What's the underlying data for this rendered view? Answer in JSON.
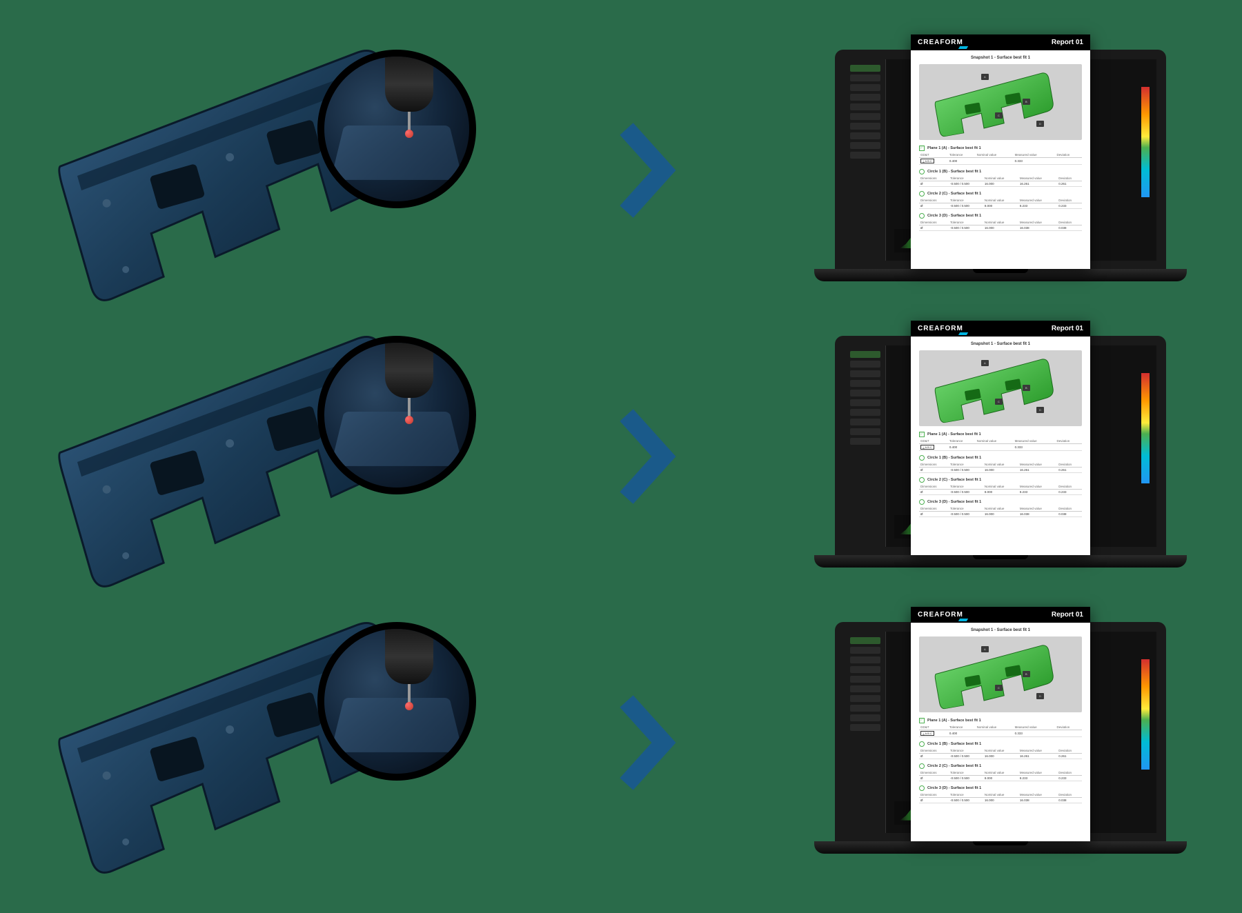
{
  "arrow_color": "#1a5a8a",
  "report": {
    "brand": "CREAFORM",
    "title": "Report 01",
    "snapshot": "Snapshot 1 - Surface best fit 1",
    "callouts": [
      "A",
      "B",
      "C",
      "D"
    ],
    "sections": [
      {
        "glyph": "plane",
        "title": "Plane 1 (A) - Surface best fit 1",
        "headers": [
          "GD&T",
          "Tolerance",
          "Nominal value",
          "Measured value",
          "Deviation"
        ],
        "rows": [
          [
            "⟂ A B C",
            "0.400",
            "",
            "0.333",
            ""
          ]
        ]
      },
      {
        "glyph": "circle",
        "title": "Circle 1 (B) - Surface best fit 1",
        "headers": [
          "Dimensions",
          "Tolerance",
          "Nominal value",
          "Measured value",
          "Deviation"
        ],
        "rows": [
          [
            "Ø",
            "-0.500 / 0.500",
            "16.000",
            "16.261",
            "0.261"
          ]
        ]
      },
      {
        "glyph": "circle",
        "title": "Circle 2 (C) - Surface best fit 1",
        "headers": [
          "Dimensions",
          "Tolerance",
          "Nominal value",
          "Measured value",
          "Deviation"
        ],
        "rows": [
          [
            "Ø",
            "-0.500 / 0.500",
            "8.000",
            "8.233",
            "0.233"
          ]
        ]
      },
      {
        "glyph": "circle",
        "title": "Circle 3 (D) - Surface best fit 1",
        "headers": [
          "Dimensions",
          "Tolerance",
          "Nominal value",
          "Measured value",
          "Deviation"
        ],
        "rows": [
          [
            "Ø",
            "-0.500 / 0.500",
            "16.000",
            "16.038",
            "0.038"
          ]
        ]
      }
    ]
  }
}
